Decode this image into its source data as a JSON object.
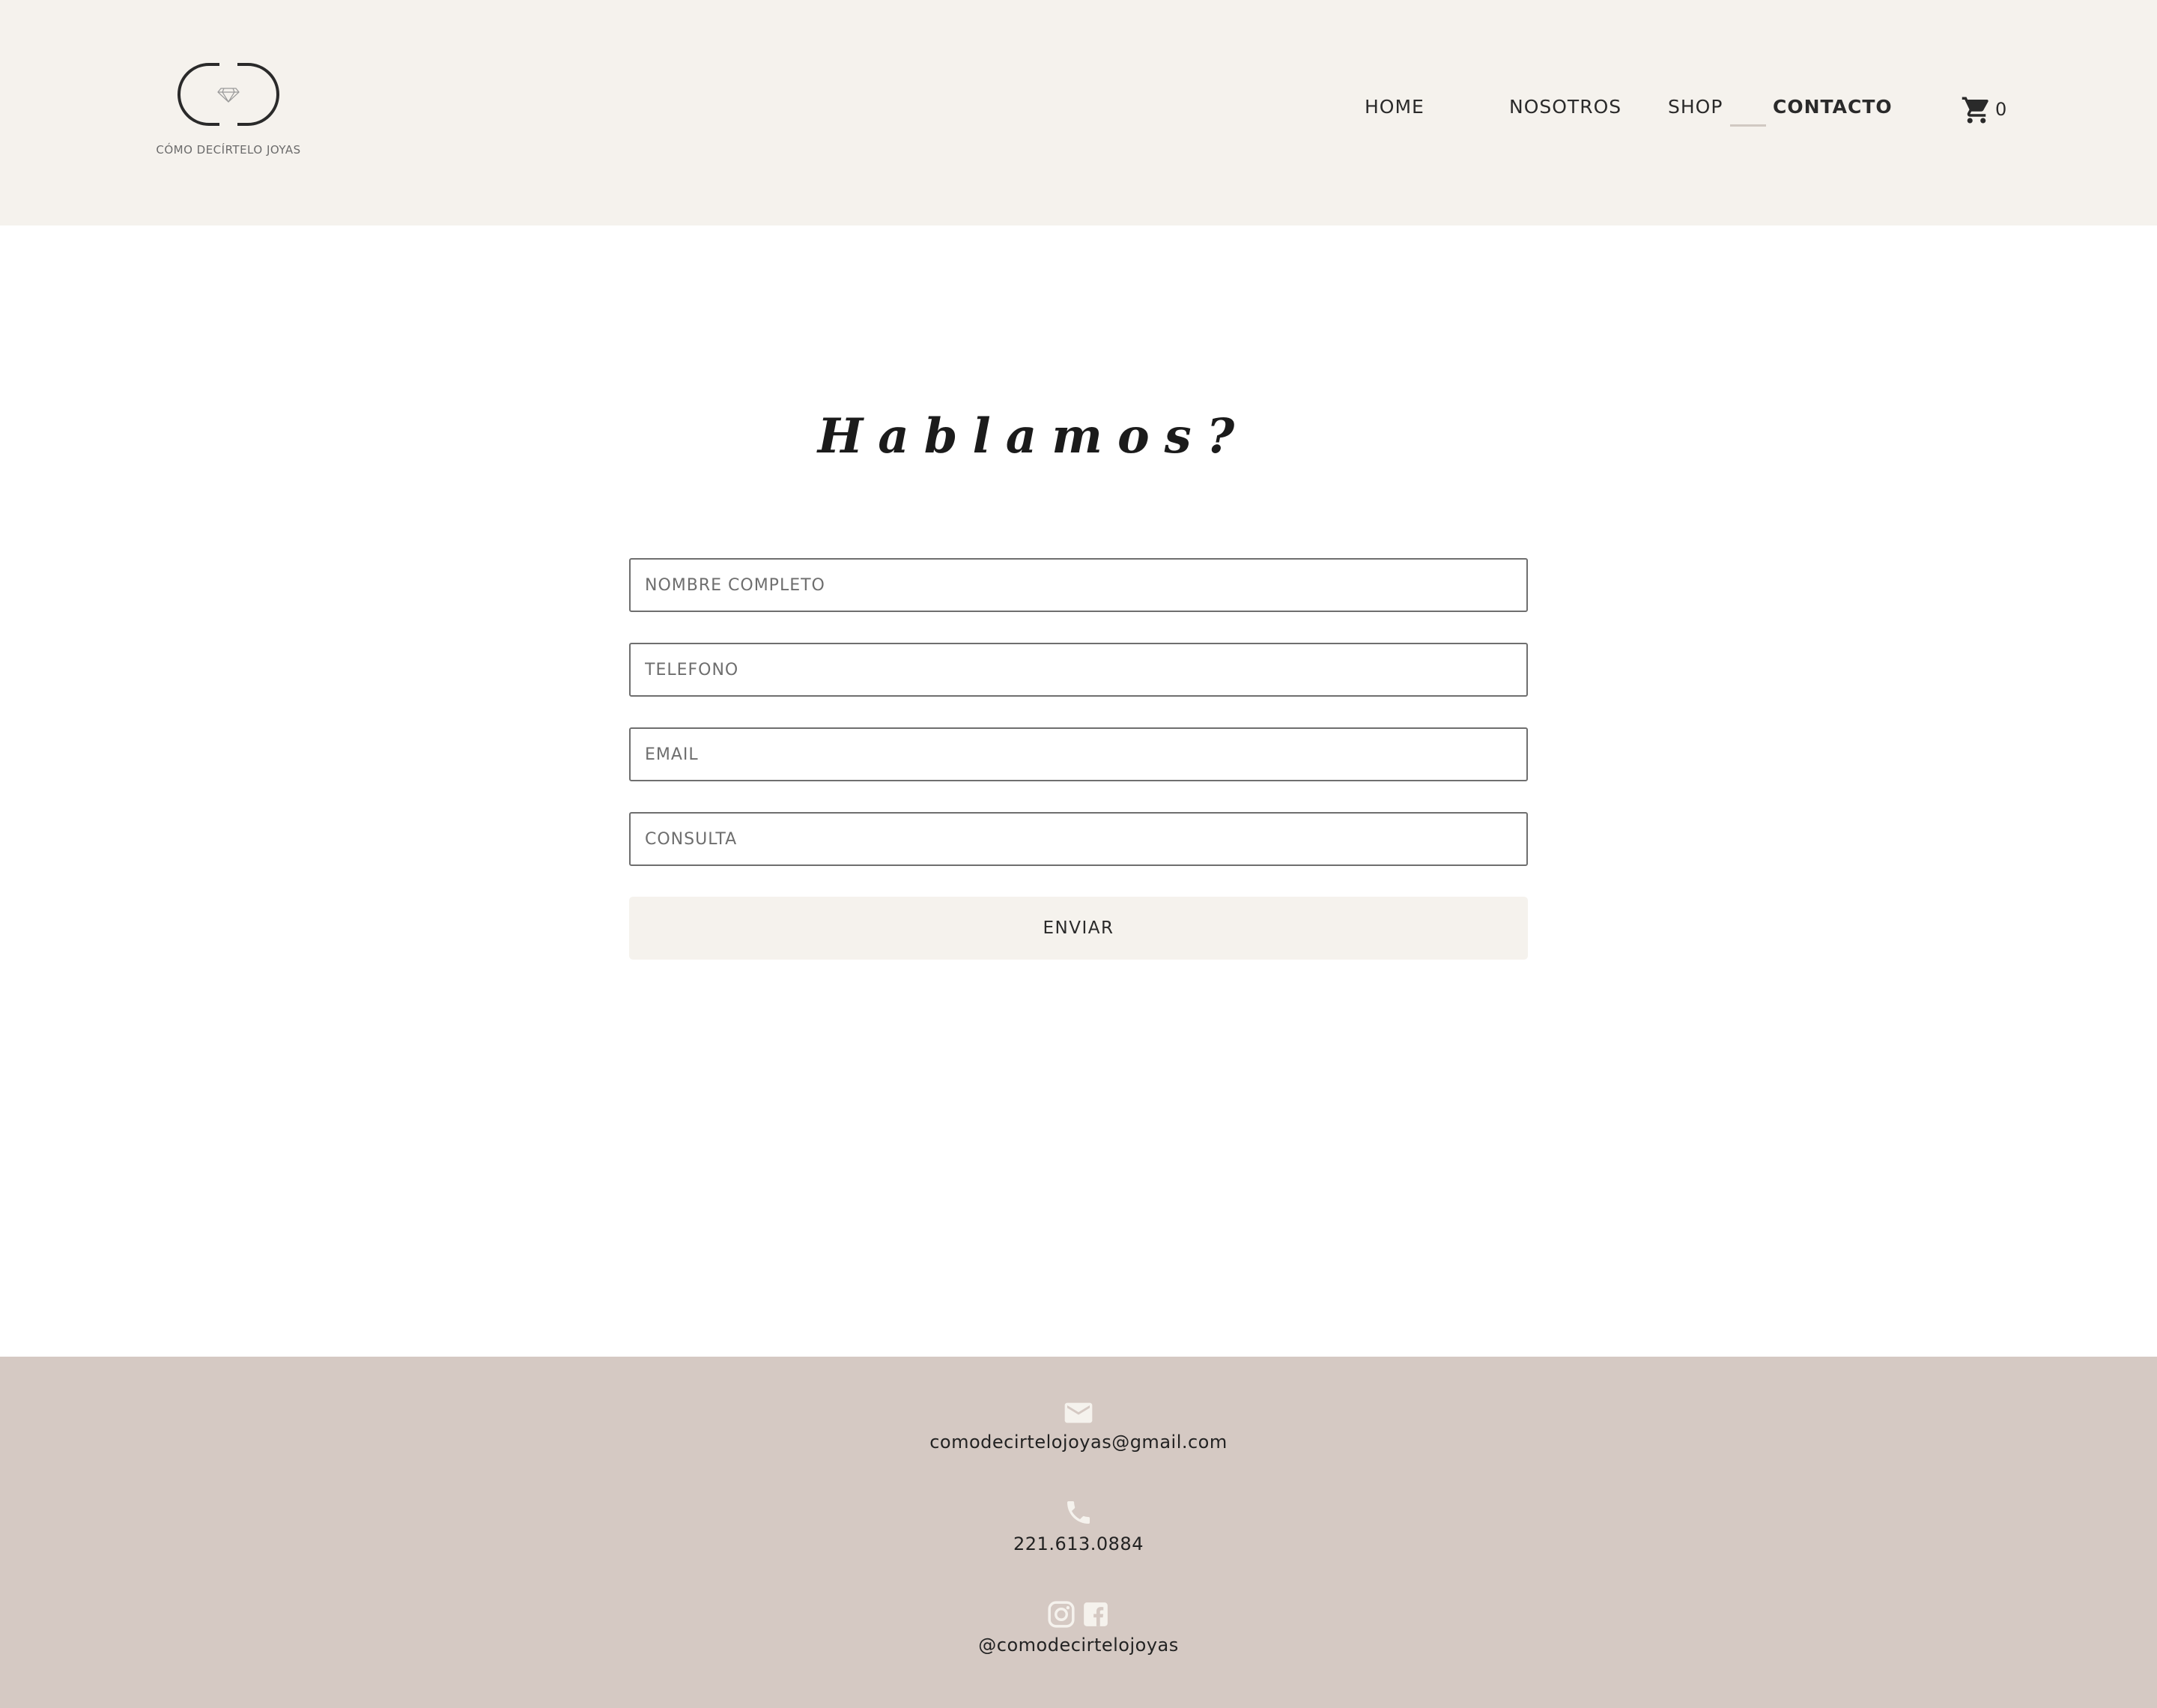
{
  "brand": {
    "logo_text": "CÓMO DECÍRTELO JOYAS",
    "logo_icon": "cd-diamond-logo"
  },
  "nav": {
    "items": [
      {
        "label": "HOME"
      },
      {
        "label": "NOSOTROS"
      },
      {
        "label": "SHOP"
      },
      {
        "label": "CONTACTO",
        "active": true
      }
    ],
    "cart_icon": "cart-icon",
    "cart_count": "0"
  },
  "contact": {
    "title": "Hablamos?",
    "fields": [
      {
        "placeholder": "NOMBRE COMPLETO",
        "value": ""
      },
      {
        "placeholder": "TELEFONO",
        "value": ""
      },
      {
        "placeholder": "EMAIL",
        "value": ""
      },
      {
        "placeholder": "CONSULTA",
        "value": ""
      }
    ],
    "submit_label": "ENVIAR"
  },
  "footer": {
    "email_icon": "mail-icon",
    "email": "comodecirtelojoyas@gmail.com",
    "phone_icon": "phone-icon",
    "phone": "221.613.0884",
    "social_icons": [
      "instagram-icon",
      "facebook-icon"
    ],
    "social_handle": "@comodecirtelojoyas"
  },
  "colors": {
    "header_bg": "#f5f2ed",
    "footer_bg": "#d5c9c3",
    "button_bg": "#f5f2ed",
    "text": "#1f1f1f"
  }
}
